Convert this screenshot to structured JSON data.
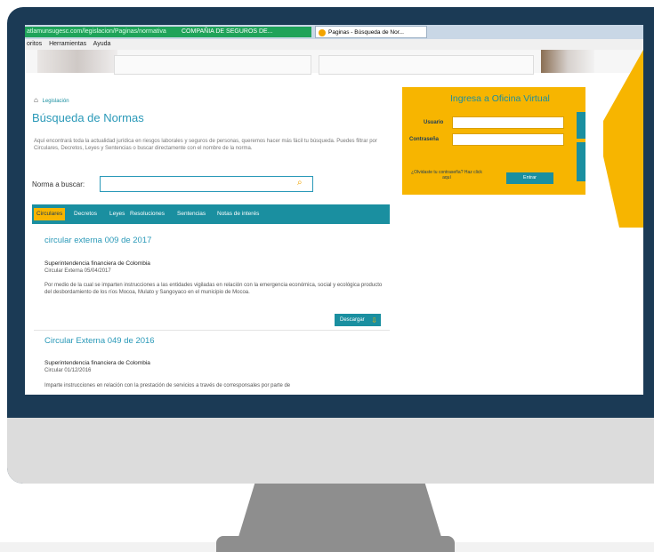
{
  "browser": {
    "address": "atlamunsugesc.com/legislacion/Paginas/normativa",
    "tab_insurer": "COMPAÑIA DE SEGUROS DE...",
    "tab_active": "Paginas - Búsqueda de Nor...",
    "menu": [
      "oritos",
      "Herramientas",
      "Ayuda"
    ]
  },
  "page": {
    "breadcrumb": "Legislación",
    "title": "Búsqueda de Normas",
    "description": "Aquí encontrará toda la actualidad jurídica en riesgos laborales y seguros de personas, queremos hacer más fácil tu búsqueda. Puedes filtrar por Circulares, Decretos, Leyes y Sentencias o buscar directamente con el nombre de la norma.",
    "search_label": "Norma a buscar:",
    "search_placeholder": "",
    "tabs": [
      "Circulares",
      "Decretos",
      "Leyes",
      "Resoluciones",
      "Sentencias",
      "Notas de interés"
    ],
    "results": [
      {
        "title": "circular externa 009 de 2017",
        "org": "Superintendencia financiera de Colombia",
        "meta": "Circular Externa   05/04/2017",
        "body": "Por medio de la cual se imparten instrucciones a las entidades vigiladas en relación con la emergencia económica, social y ecológica producto del desbordamiento de los ríos Mocoa, Mulato y Sangoyaco en el municipio de Mocoa.",
        "download": "Descargar"
      },
      {
        "title": "Circular Externa 049 de 2016",
        "org": "Superintendencia financiera de Colombia",
        "meta": "Circular   01/12/2016",
        "body": "Imparte instrucciones en relación con la prestación de servicios a través de corresponsales por parte de"
      }
    ]
  },
  "login": {
    "title": "Ingresa a Oficina Virtual",
    "user_label": "Usuario",
    "password_label": "Contraseña",
    "forgot": "¿Olvidaste tu contraseña? Haz click aquí",
    "button": "Entrar"
  },
  "colors": {
    "frame": "#1b3a55",
    "teal": "#1a8fa0",
    "yellow": "#f7b500",
    "title_blue": "#2a99b8"
  }
}
